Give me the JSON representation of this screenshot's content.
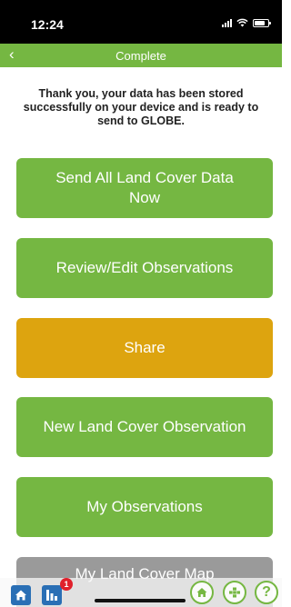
{
  "status": {
    "time": "12:24"
  },
  "nav": {
    "title": "Complete",
    "back_glyph": "‹"
  },
  "message": "Thank you, your data has been stored successfully on your device and is ready to send to GLOBE.",
  "buttons": {
    "send_all": "Send All Land Cover Data Now",
    "review_edit": "Review/Edit Observations",
    "share": "Share",
    "new_observation": "New Land Cover Observation",
    "my_observations": "My Observations",
    "my_map": "My Land Cover Map"
  },
  "bottom": {
    "badge_count": "1",
    "help_glyph": "?"
  },
  "colors": {
    "green": "#75b742",
    "orange": "#dda40f",
    "gray": "#9a9a9a",
    "blue": "#2a6fb5"
  },
  "icons": [
    "back-chevron-icon",
    "signal-icon",
    "wifi-icon",
    "battery-icon",
    "home-icon",
    "bar-chart-icon",
    "home-circle-icon",
    "grid-icon",
    "help-icon"
  ]
}
